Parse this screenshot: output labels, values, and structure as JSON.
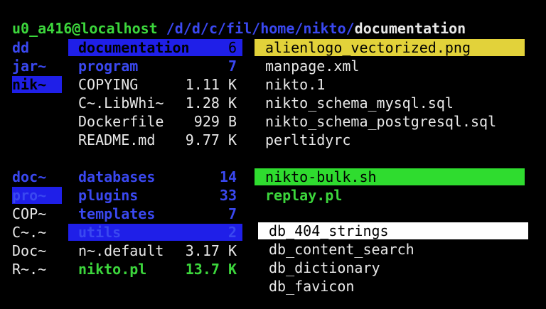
{
  "colors": {
    "background": "#000000",
    "green": "#3cd63c",
    "blue": "#3a48f0",
    "blue_selection": "#1f1fe8",
    "yellow_selection": "#e2d23a",
    "green_selection": "#2fdc2f",
    "white_selection": "#ffffff",
    "text": "#e8e8e8"
  },
  "header": {
    "user_host": "u0_a416@localhost",
    "path_prefix": "/d/d/c/fil/home/nikto/",
    "path_current": "documentation"
  },
  "top": {
    "parent": [
      {
        "name": "dd"
      },
      {
        "name": "jar~"
      },
      {
        "name": "nik~"
      }
    ],
    "current": [
      {
        "name": "documentation",
        "size": "6"
      },
      {
        "name": "program",
        "size": "7"
      },
      {
        "name": "COPYING",
        "size": "1.11 K"
      },
      {
        "name": "C~.LibWhi~",
        "size": "1.28 K"
      },
      {
        "name": "Dockerfile",
        "size": "929 B"
      },
      {
        "name": "README.md",
        "size": "9.77 K"
      }
    ],
    "next": [
      {
        "name": "alienlogo_vectorized.png"
      },
      {
        "name": "manpage.xml"
      },
      {
        "name": "nikto.1"
      },
      {
        "name": "nikto_schema_mysql.sql"
      },
      {
        "name": "nikto_schema_postgresql.sql"
      },
      {
        "name": "perltidyrc"
      }
    ]
  },
  "bottom": {
    "parent": [
      {
        "name": "doc~"
      },
      {
        "name": "pro~"
      },
      {
        "name": "COP~"
      },
      {
        "name": "C~.~"
      },
      {
        "name": "Doc~"
      },
      {
        "name": "R~.~"
      }
    ],
    "current": [
      {
        "name": "databases",
        "size": "14"
      },
      {
        "name": "plugins",
        "size": "33"
      },
      {
        "name": "templates",
        "size": "7"
      },
      {
        "name": "utils",
        "size": "2"
      },
      {
        "name": "n~.default",
        "size": "3.17 K"
      },
      {
        "name": "nikto.pl",
        "size": "13.7 K"
      }
    ],
    "next_top": [
      {
        "name": "nikto-bulk.sh"
      },
      {
        "name": "replay.pl"
      }
    ],
    "next_bottom": [
      {
        "name": "db_404_strings"
      },
      {
        "name": "db_content_search"
      },
      {
        "name": "db_dictionary"
      },
      {
        "name": "db_favicon"
      }
    ]
  }
}
